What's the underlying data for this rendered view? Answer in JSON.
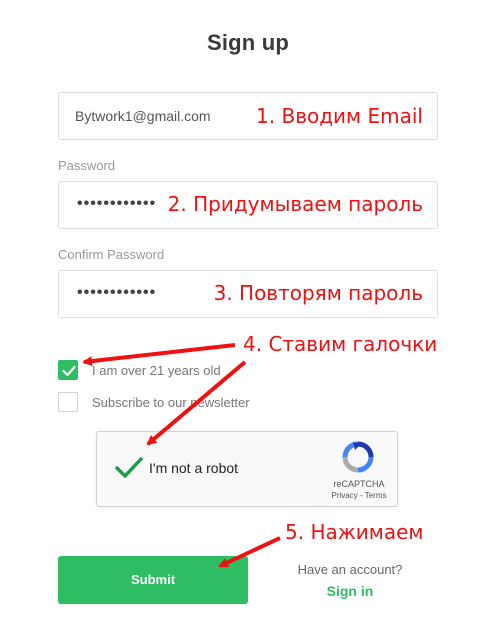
{
  "page": {
    "title": "Sign up"
  },
  "email": {
    "value": "Bytwork1@gmail.com",
    "annotation": "1. Вводим Email"
  },
  "password": {
    "label": "Password",
    "value": "••••••••••••",
    "annotation": "2. Придумываем пароль"
  },
  "confirm": {
    "label": "Confirm Password",
    "value": "••••••••••••",
    "annotation": "3. Повторям пароль"
  },
  "annotations": {
    "checkboxes": "4. Ставим галочки",
    "submit": "5. Нажимаем"
  },
  "checkboxes": {
    "age": {
      "label": "I am over 21 years old",
      "checked": true
    },
    "newsletter": {
      "label": "Subscribe to our newsletter",
      "checked": false
    }
  },
  "recaptcha": {
    "label": "I'm not a robot",
    "brand": "reCAPTCHA",
    "links": "Privacy - Terms",
    "checked": true
  },
  "submit": {
    "label": "Submit"
  },
  "footer": {
    "have_account": "Have an account?",
    "sign_in": "Sign in"
  },
  "colors": {
    "accent": "#2ebd63",
    "annotation": "#ee1111"
  }
}
